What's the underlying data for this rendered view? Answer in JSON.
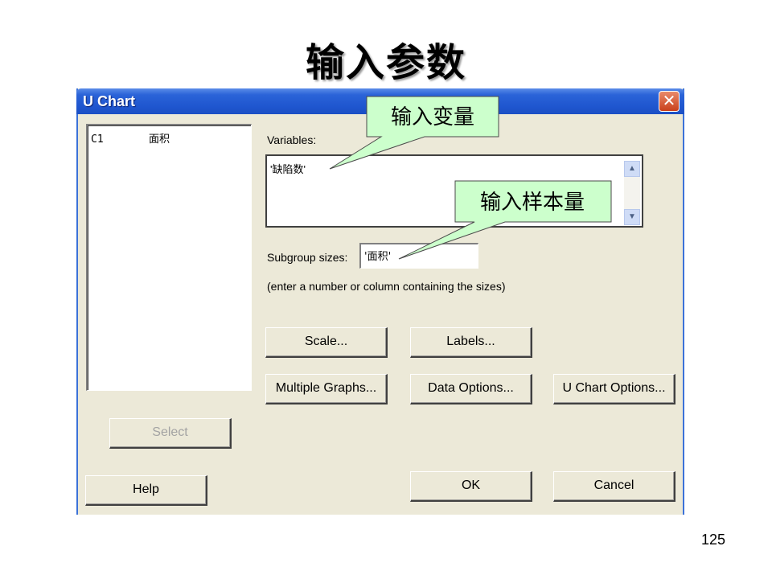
{
  "slide": {
    "title": "输入参数",
    "page_number": "125"
  },
  "dialog": {
    "title": "U Chart",
    "close_symbol": "✕",
    "columns": [
      {
        "id": "C1",
        "name": "面积"
      }
    ],
    "variables_label": "Variables:",
    "variables_value": "'缺陷数'",
    "subgroup_label": "Subgroup sizes:",
    "subgroup_value": "'面积'",
    "hint": "(enter a number or column containing the sizes)",
    "buttons": {
      "scale": "Scale...",
      "labels": "Labels...",
      "multiple_graphs": "Multiple Graphs...",
      "data_options": "Data Options...",
      "uchart_options": "U Chart Options...",
      "select": "Select",
      "help": "Help",
      "ok": "OK",
      "cancel": "Cancel"
    }
  },
  "callouts": {
    "input_variable": "输入变量",
    "input_sample_size": "输入样本量"
  },
  "colors": {
    "titlebar": "#2a63d8",
    "dialog_bg": "#ece9d8",
    "callout_fill": "#ccffcc"
  },
  "icons": {
    "close": "close-icon",
    "scroll_up": "scroll-up-arrow-icon",
    "scroll_down": "scroll-down-arrow-icon"
  }
}
